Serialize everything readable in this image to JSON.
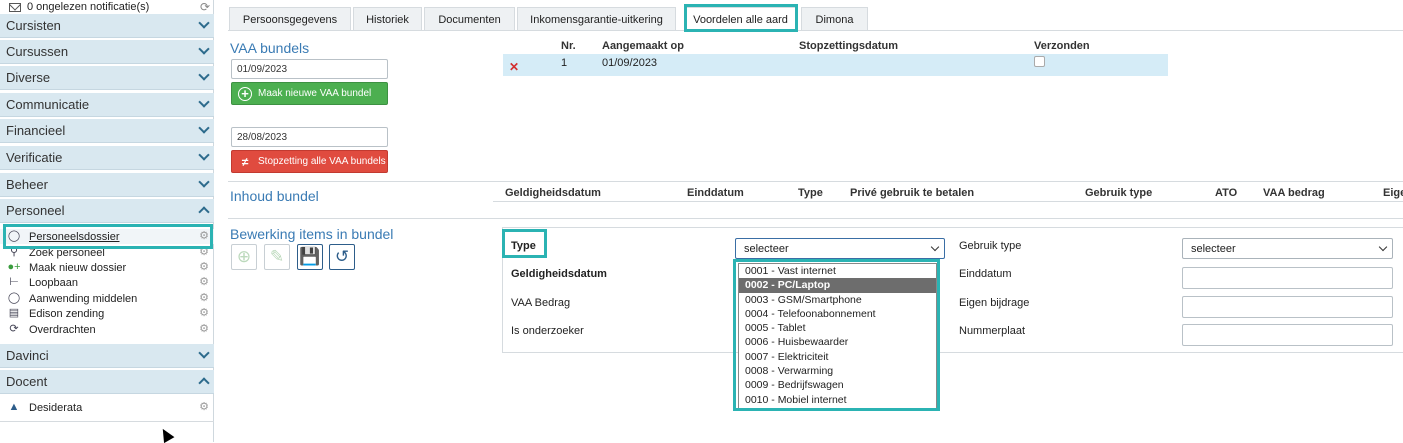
{
  "sidebar": {
    "notifications": "0 ongelezen notificatie(s)",
    "groups": [
      {
        "label": "Cursisten"
      },
      {
        "label": "Cursussen"
      },
      {
        "label": "Diverse"
      },
      {
        "label": "Communicatie"
      },
      {
        "label": "Financieel"
      },
      {
        "label": "Verificatie"
      },
      {
        "label": "Beheer"
      },
      {
        "label": "Personeel"
      },
      {
        "label": "Davinci"
      },
      {
        "label": "Docent"
      }
    ],
    "personeel_items": [
      {
        "label": "Personeelsdossier",
        "icon": "user-icon"
      },
      {
        "label": "Zoek personeel",
        "icon": "search-icon"
      },
      {
        "label": "Maak nieuw dossier",
        "icon": "add-user-icon"
      },
      {
        "label": "Loopbaan",
        "icon": "sitemap-icon"
      },
      {
        "label": "Aanwending middelen",
        "icon": "user-icon"
      },
      {
        "label": "Edison zending",
        "icon": "list-icon"
      },
      {
        "label": "Overdrachten",
        "icon": "refresh-icon"
      }
    ],
    "docent_items": [
      {
        "label": "Desiderata",
        "icon": "graduation-cap-icon"
      }
    ]
  },
  "tabs": [
    {
      "label": "Persoonsgegevens"
    },
    {
      "label": "Historiek"
    },
    {
      "label": "Documenten"
    },
    {
      "label": "Inkomensgarantie-uitkering"
    },
    {
      "label": "Voordelen alle aard"
    },
    {
      "label": "Dimona"
    }
  ],
  "vaa": {
    "title": "VAA bundels",
    "date1": "01/09/2023",
    "create_button": "Maak nieuwe VAA bundel",
    "date2": "28/08/2023",
    "stop_button": "Stopzetting alle VAA bundels",
    "columns": {
      "nr": "Nr.",
      "created": "Aangemaakt op",
      "stopped": "Stopzettingsdatum",
      "sent": "Verzonden"
    },
    "rows": [
      {
        "nr": "1",
        "created": "01/09/2023",
        "stopped": "",
        "sent": false
      }
    ]
  },
  "contents": {
    "title": "Inhoud bundel",
    "columns": [
      "Geldigheidsdatum",
      "Einddatum",
      "Type",
      "Privé gebruik te betalen",
      "Gebruik type",
      "ATO",
      "VAA bedrag",
      "Eige"
    ]
  },
  "editing": {
    "title": "Bewerking items in bundel",
    "labels": {
      "type": "Type",
      "validity": "Geldigheidsdatum",
      "amount": "VAA Bedrag",
      "researcher": "Is onderzoeker",
      "use_type": "Gebruik type",
      "end_date": "Einddatum",
      "own_contribution": "Eigen bijdrage",
      "plate": "Nummerplaat"
    },
    "type_select_value": "selecteer",
    "use_type_select_value": "selecteer",
    "type_options": [
      {
        "label": "0001 - Vast internet"
      },
      {
        "label": "0002 - PC/Laptop"
      },
      {
        "label": "0003 - GSM/Smartphone"
      },
      {
        "label": "0004 - Telefoonabonnement"
      },
      {
        "label": "0005 - Tablet"
      },
      {
        "label": "0006 - Huisbewaarder"
      },
      {
        "label": "0007 - Elektriciteit"
      },
      {
        "label": "0008 - Verwarming"
      },
      {
        "label": "0009 - Bedrijfswagen"
      },
      {
        "label": "0010 - Mobiel internet"
      }
    ]
  }
}
